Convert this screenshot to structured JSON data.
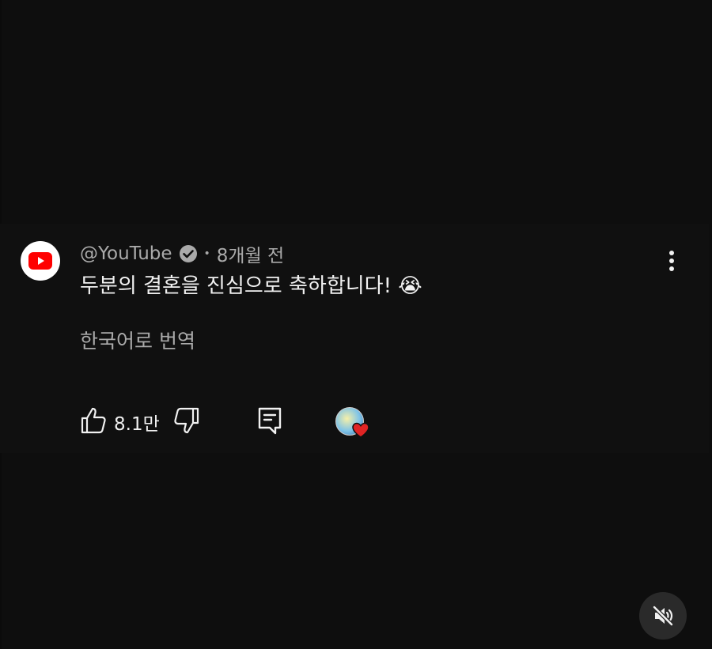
{
  "comment": {
    "author": "@YouTube",
    "time_ago": "8개월 전",
    "separator": "•",
    "text": "두분의 결혼을 진심으로 축하합니다! 😭",
    "translate_label": "한국어로 번역",
    "like_count": "8.1만"
  },
  "icons": {
    "avatar": "youtube-logo",
    "verified": "verified-check-icon",
    "menu": "more-vertical-icon",
    "like": "thumbs-up-icon",
    "dislike": "thumbs-down-icon",
    "reply": "comment-icon",
    "creator_heart": "creator-heart-icon",
    "mute": "volume-muted-icon"
  },
  "colors": {
    "background": "#0e0e0e",
    "primary_text": "#f1f1f1",
    "secondary_text": "#aaaaaa",
    "youtube_red": "#ff0000",
    "heart_red": "#e02424"
  }
}
